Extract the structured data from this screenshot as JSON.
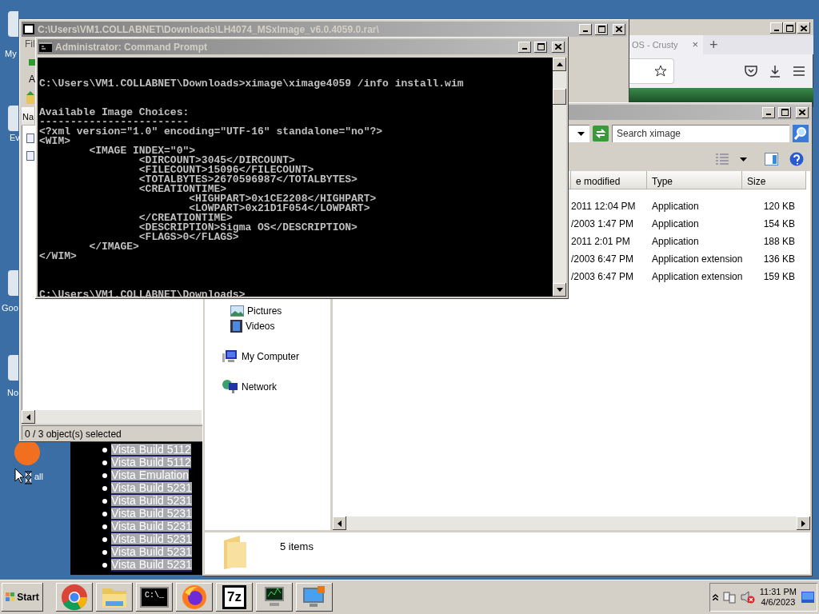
{
  "desktop_icons": [
    {
      "label": "My"
    },
    {
      "label": "Ev"
    },
    {
      "label": "Goo"
    },
    {
      "label": "No"
    },
    {
      "label": "all"
    }
  ],
  "list_window": {
    "items": [
      "Vista Build 5112",
      "Vista Build 5112",
      "Vista Emulation",
      "Vista Build 5231",
      "Vista Build 5231",
      "Vista Build 5231",
      "Vista Build 5231",
      "Vista Build 5231",
      "Vista Build 5231",
      "Vista Build 5231"
    ]
  },
  "browser_window": {
    "tab_title": "OS - Crusty",
    "tab_close": "×",
    "new_tab": "+"
  },
  "archive_window": {
    "title": "C:\\Users\\VM1.COLLABNET\\Downloads\\LH4074_MSxImage_v6.0.4059.0.rar\\",
    "menu": [
      "Fil"
    ],
    "address_label": "A",
    "column_header": "Na",
    "status": "0 / 3 object(s) selected"
  },
  "explorer_window": {
    "search": {
      "placeholder": "Search ximage"
    },
    "columns": [
      "e modified",
      "Type",
      "Size"
    ],
    "rows": [
      {
        "date": "2011 12:04 PM",
        "type": "Application",
        "size": "120 KB"
      },
      {
        "date": "/2003 1:47 PM",
        "type": "Application",
        "size": "154 KB"
      },
      {
        "date": "2011 2:01 PM",
        "type": "Application",
        "size": "188 KB"
      },
      {
        "date": "/2003 6:47 PM",
        "type": "Application extension",
        "size": "136 KB"
      },
      {
        "date": "/2003 6:47 PM",
        "type": "Application extension",
        "size": "159 KB"
      }
    ],
    "nav_items": [
      {
        "label": "Pictures",
        "kind": "pictures"
      },
      {
        "label": "Videos",
        "kind": "videos"
      },
      {
        "label": "My Computer",
        "kind": "computer"
      },
      {
        "label": "Network",
        "kind": "network"
      }
    ],
    "status": "5 items"
  },
  "cmd_window": {
    "title": "Administrator: Command Prompt",
    "blocks": [
      [
        "C:\\Users\\VM1.COLLABNET\\Downloads>ximage\\ximage4059 /info install.wim"
      ],
      [
        "Available Image Choices:",
        "------------------------",
        "<?xml version=\"1.0\" encoding=\"UTF-16\" standalone=\"no\"?>",
        "<WIM>",
        "        <IMAGE INDEX=\"0\">",
        "                <DIRCOUNT>3045</DIRCOUNT>",
        "                <FILECOUNT>15096</FILECOUNT>",
        "                <TOTALBYTES>2670596987</TOTALBYTES>",
        "                <CREATIONTIME>",
        "                        <HIGHPART>0x1CE2208</HIGHPART>",
        "                        <LOWPART>0x21D1F054</LOWPART>",
        "                </CREATIONTIME>",
        "                <DESCRIPTION>Sigma OS</DESCRIPTION>",
        "                <FLAGS>0</FLAGS>",
        "        </IMAGE>",
        "</WIM>"
      ],
      [
        "C:\\Users\\VM1.COLLABNET\\Downloads>"
      ]
    ]
  },
  "taskbar": {
    "start": "Start",
    "apps": [
      {
        "kind": "wheel"
      },
      {
        "kind": "folder"
      },
      {
        "kind": "console",
        "label": "C:\\_"
      },
      {
        "kind": "globe"
      },
      {
        "kind": "archive",
        "label": "7z"
      },
      {
        "kind": "monitor"
      },
      {
        "kind": "remote"
      }
    ],
    "clock": {
      "time": "11:31 PM",
      "date": "4/6/2023"
    }
  }
}
